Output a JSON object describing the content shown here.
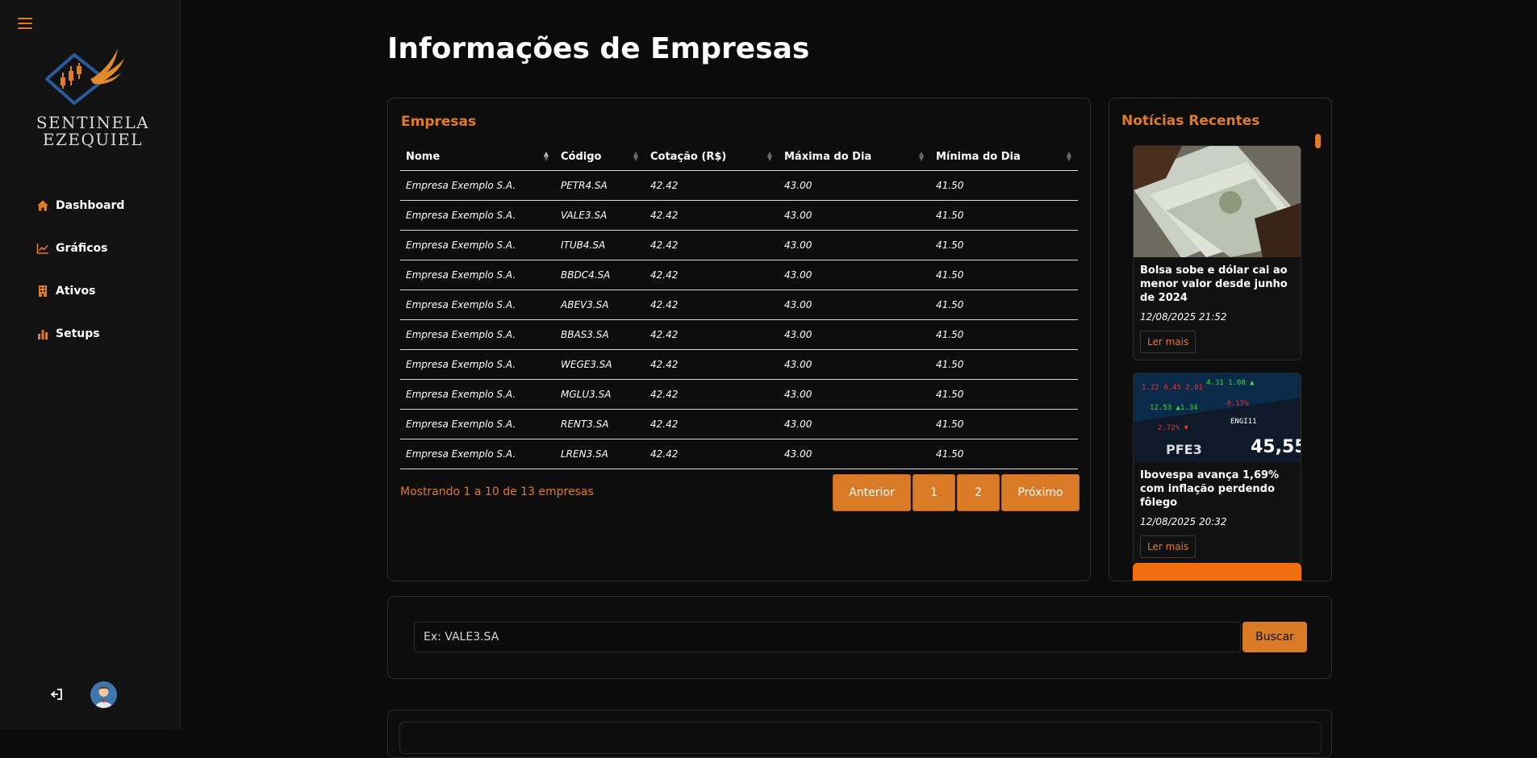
{
  "sidebar": {
    "logo_text_line1": "SENTINELA",
    "logo_text_line2": "EZEQUIEL",
    "items": [
      {
        "label": "Dashboard",
        "icon": "home-icon"
      },
      {
        "label": "Gráficos",
        "icon": "chart-line-icon"
      },
      {
        "label": "Ativos",
        "icon": "building-icon"
      },
      {
        "label": "Setups",
        "icon": "bar-chart-icon"
      }
    ]
  },
  "page": {
    "title": "Informações de Empresas"
  },
  "companies": {
    "title": "Empresas",
    "columns": [
      "Nome",
      "Código",
      "Cotação (R$)",
      "Máxima do Dia",
      "Mínima do Dia"
    ],
    "rows": [
      [
        "Empresa Exemplo S.A.",
        "PETR4.SA",
        "42.42",
        "43.00",
        "41.50"
      ],
      [
        "Empresa Exemplo S.A.",
        "VALE3.SA",
        "42.42",
        "43.00",
        "41.50"
      ],
      [
        "Empresa Exemplo S.A.",
        "ITUB4.SA",
        "42.42",
        "43.00",
        "41.50"
      ],
      [
        "Empresa Exemplo S.A.",
        "BBDC4.SA",
        "42.42",
        "43.00",
        "41.50"
      ],
      [
        "Empresa Exemplo S.A.",
        "ABEV3.SA",
        "42.42",
        "43.00",
        "41.50"
      ],
      [
        "Empresa Exemplo S.A.",
        "BBAS3.SA",
        "42.42",
        "43.00",
        "41.50"
      ],
      [
        "Empresa Exemplo S.A.",
        "WEGE3.SA",
        "42.42",
        "43.00",
        "41.50"
      ],
      [
        "Empresa Exemplo S.A.",
        "MGLU3.SA",
        "42.42",
        "43.00",
        "41.50"
      ],
      [
        "Empresa Exemplo S.A.",
        "RENT3.SA",
        "42.42",
        "43.00",
        "41.50"
      ],
      [
        "Empresa Exemplo S.A.",
        "LREN3.SA",
        "42.42",
        "43.00",
        "41.50"
      ]
    ],
    "showing": "Mostrando 1 a 10 de 13 empresas",
    "pager": {
      "prev": "Anterior",
      "pages": [
        "1",
        "2"
      ],
      "next": "Próximo"
    }
  },
  "news": {
    "title": "Notícias Recentes",
    "items": [
      {
        "headline": "Bolsa sobe e dólar cai ao menor valor desde junho de 2024",
        "date": "12/08/2025 21:52",
        "button": "Ler mais"
      },
      {
        "headline": "Ibovespa avança 1,69% com inflação perdendo fôlego",
        "date": "12/08/2025 20:32",
        "button": "Ler mais"
      }
    ]
  },
  "search": {
    "placeholder": "Ex: VALE3.SA",
    "button": "Buscar"
  },
  "colors": {
    "accent": "#e07b26",
    "background": "#0b0b0c",
    "sidebar": "#121213"
  }
}
